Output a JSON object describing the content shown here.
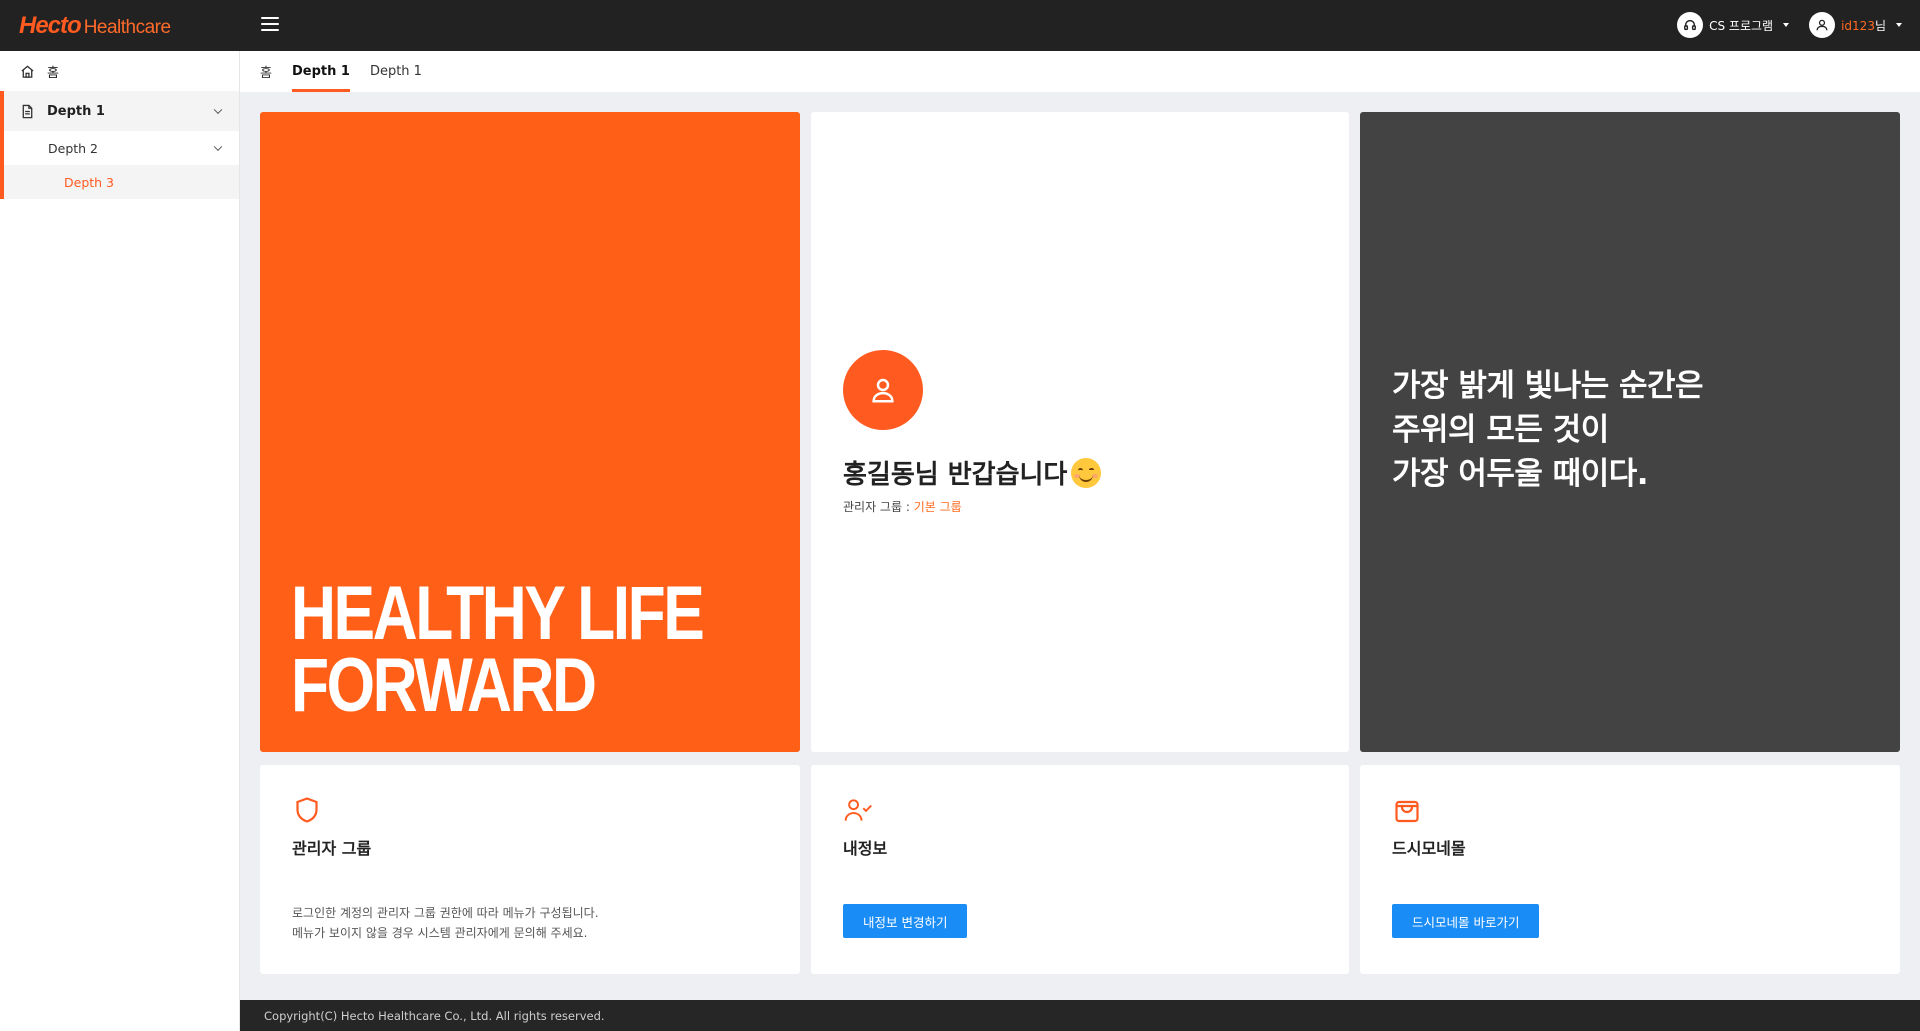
{
  "header": {
    "logo_hecto": "Hecto",
    "logo_healthcare": "Healthcare",
    "cs_program": "CS 프로그램",
    "user_id": "id123",
    "user_suffix": "님"
  },
  "sidebar": {
    "home": "홈",
    "depth1": "Depth 1",
    "depth2": "Depth 2",
    "depth3": "Depth 3"
  },
  "breadcrumb": {
    "home": "홈",
    "items": [
      "Depth 1",
      "Depth 1"
    ]
  },
  "hero": {
    "slogan_line1": "HEALTHY LIFE",
    "slogan_line2": "FORWARD"
  },
  "profile": {
    "greeting": "홍길동님 반갑습니다",
    "group_label": "관리자 그룹 : ",
    "group_value": "기본 그룹"
  },
  "quote": {
    "line1": "가장 밝게 빛나는 순간은",
    "line2": "주위의 모든 것이",
    "line3": "가장 어두울 때이다."
  },
  "cards": {
    "admin": {
      "title": "관리자 그룹",
      "desc_line1": "로그인한 계정의 관리자 그룹 권한에 따라 메뉴가 구성됩니다.",
      "desc_line2": "메뉴가 보이지 않을 경우 시스템 관리자에게 문의해 주세요."
    },
    "myinfo": {
      "title": "내정보",
      "button": "내정보 변경하기"
    },
    "mall": {
      "title": "드시모네몰",
      "button": "드시모네몰 바로가기"
    }
  },
  "footer": {
    "copyright": "Copyright(C) Hecto Healthcare Co., Ltd. All rights reserved."
  },
  "colors": {
    "accent": "#ff5a1f",
    "header_bg": "#222222",
    "button_blue": "#1a8cf5",
    "dark_card": "#434343"
  }
}
